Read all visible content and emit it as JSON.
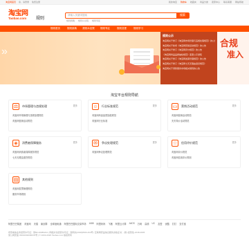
{
  "topbar": {
    "left": [
      "淘宝网首页",
      "亲，请登录",
      "免费注册"
    ],
    "right": [
      "我的淘宝",
      "购物车",
      "收藏夹",
      "商品分类",
      "卖家中心",
      "联系客服",
      "网站导航"
    ]
  },
  "logo": {
    "cn": "淘宝网",
    "en": "Taobao.com",
    "sub": "规则"
  },
  "search": {
    "placeholder": "请输入关键词搜索",
    "button": "搜索"
  },
  "hot_terms": [
    "规则辞典",
    "规则众议院",
    "规则专区"
  ],
  "nav": [
    "规则首页",
    "规则辞典",
    "规则众议院",
    "规则专区",
    "规则变更",
    "规则学习"
  ],
  "banner": {
    "side_head": "规则公示",
    "side_lines": [
      "淘宝网关于修订《淘宝网市场管理与违规处理规范》的公告",
      "淘宝网关于新增《淘宝网营销活动规范》的公告",
      "淘宝网关于修订《淘宝网评价规范》的公告",
      "《淘宝网商品品质抽检规范》变更公示通知",
      "淘宝网关于修订《淘宝网发票管理规范》的公告",
      "淘宝网关于修订《淘宝网七天无理由退货规范》",
      "淘宝网关于调整服务市场相关规则的公告"
    ],
    "side_img_text": [
      "合规",
      "准入"
    ]
  },
  "section_title": "淘宝平台规则导航",
  "cards": [
    {
      "title": "市场管理与违规处理",
      "icon": "scale-icon",
      "more": "更多",
      "links": [
        "淘宝网市场管理与违规处理规范",
        "淘宝网营销活动规范"
      ]
    },
    {
      "title": "行业标准规范",
      "icon": "people-icon",
      "more": "更多",
      "links": [
        "淘宝网商品品质抽检规范",
        "淘宝网行业标准"
      ]
    },
    {
      "title": "营销活动规范",
      "icon": "monitor-icon",
      "more": "更多",
      "links": [
        "淘宝网营销活动规范",
        "天天特价活动规范"
      ]
    },
    {
      "title": "消费者保障服务",
      "icon": "shield-icon",
      "more": "更多",
      "links": [
        "淘宝网消费者保障服务规范",
        "七天无理由退货规范"
      ]
    },
    {
      "title": "争议处理规范",
      "icon": "chat-icon",
      "more": "更多",
      "links": [
        "淘宝网争议处理规范"
      ]
    },
    {
      "title": "信用评价规范",
      "icon": "star-icon",
      "more": "更多",
      "links": [
        "淘宝网评价规范",
        "淘宝网信用评价规则"
      ]
    },
    {
      "title": "其他规则",
      "icon": "doc-icon",
      "more": "",
      "links": [
        "淘宝网发票管理规范",
        "服务市场规则"
      ]
    }
  ],
  "footer_links": [
    "阿里巴巴集团",
    "淘宝网",
    "天猫",
    "聚划算",
    "全球速卖通",
    "阿里巴巴国际交易市场",
    "1688",
    "阿里妈妈",
    "飞猪",
    "阿里云计算",
    "AliOS",
    "万网",
    "高德",
    "UC",
    "友盟",
    "优酷",
    "钉钉",
    "支付宝"
  ],
  "footer_info": [
    "增值电信业务经营许可证：浙B2-20080224  |  网络文化经营许可证：浙网文[2018]3506-263号  |  互联网药品信息服务资格证书：(浙)-经营性-2018-0005",
    "浙公网安备 33010002000078号  |  © 2003-2020 Taobao.com 版权所有"
  ]
}
